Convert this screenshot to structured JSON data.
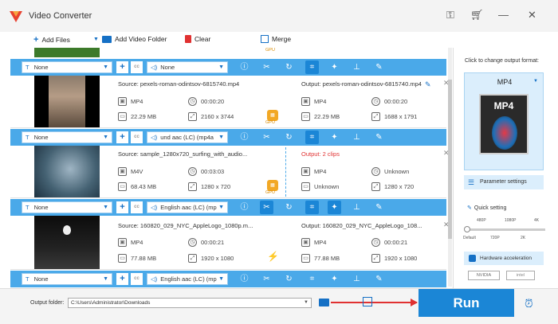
{
  "window": {
    "title": "Video Converter"
  },
  "toolbar": {
    "add_files": "Add Files",
    "add_video_folder": "Add Video Folder",
    "clear": "Clear",
    "merge": "Merge"
  },
  "common": {
    "none": "None",
    "gpu": "GPU"
  },
  "rows": [
    {
      "subtitle": "None",
      "audio": "None",
      "source": "Source: pexels-roman-odintsov-6815740.mp4",
      "format": "MP4",
      "duration": "00:00:20",
      "size": "22.29 MB",
      "resolution": "2160 x 3744",
      "output": "Output: pexels-roman-odintsov-6815740.mp4",
      "out_format": "MP4",
      "out_duration": "00:00:20",
      "out_size": "22.29 MB",
      "out_resolution": "1688 x 1791"
    },
    {
      "subtitle": "None",
      "audio": "und aac (LC) (mp4a",
      "source": "Source: sample_1280x720_surfing_with_audio...",
      "format": "M4V",
      "duration": "00:03:03",
      "size": "68.43 MB",
      "resolution": "1280 x 720",
      "output": "Output: 2 clips",
      "out_format": "MP4",
      "out_duration": "Unknown",
      "out_size": "Unknown",
      "out_resolution": "1280 x 720"
    },
    {
      "subtitle": "None",
      "audio": "English aac (LC) (mp",
      "source": "Source: 160820_029_NYC_AppleLogo_1080p.m...",
      "format": "MP4",
      "duration": "00:00:21",
      "size": "77.88 MB",
      "resolution": "1920 x 1080",
      "output": "Output: 160820_029_NYC_AppleLogo_108...",
      "out_format": "MP4",
      "out_duration": "00:00:21",
      "out_size": "77.88 MB",
      "out_resolution": "1920 x 1080"
    }
  ],
  "last_bar": {
    "subtitle": "None",
    "audio": "English aac (LC) (mp"
  },
  "panel": {
    "click_hint": "Click to change output format:",
    "format": "MP4",
    "parameter_settings": "Parameter settings",
    "quick_setting": "Quick setting",
    "q_top": [
      "480P",
      "1080P",
      "4K"
    ],
    "q_bottom": [
      "Default",
      "720P",
      "2K"
    ],
    "hw_accel": "Hardware acceleration",
    "nvidia": "NVIDIA",
    "intel": "intel"
  },
  "bottom": {
    "output_folder_label": "Output folder:",
    "output_folder": "C:\\Users\\Administrator\\Downloads",
    "run": "Run"
  },
  "colors": {
    "accent": "#4aa9e9",
    "run": "#1b86d6",
    "gpu": "#f2a825",
    "annotation": "#e03131"
  }
}
